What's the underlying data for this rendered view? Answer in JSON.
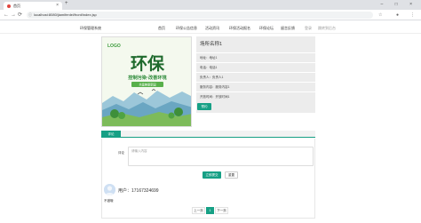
{
  "browser": {
    "tab_title": "首页",
    "tab_close": "×",
    "new_tab": "+",
    "window_controls": "– □ ×",
    "url": "localhost:8080/jiamifenlei/front/index.jsp",
    "back": "←",
    "forward": "→",
    "reload": "⟳",
    "lock": "ⓘ",
    "read_mode": "☆",
    "profile": "●",
    "menu": "⋮"
  },
  "site": {
    "brand": "环保管理系统",
    "nav": [
      "首页",
      "环保公告信息",
      "活动资讯",
      "环保活动报名",
      "环保论坛",
      "留言反馈",
      "登录",
      "跳转到后台"
    ]
  },
  "poster": {
    "logo": "LOGO",
    "headline": "环保",
    "slogan": "控制污染·改善环境",
    "tagline": "共建美丽家园"
  },
  "detail": {
    "title": "场所名称1",
    "fields": [
      {
        "label": "地址：",
        "value": "地址1"
      },
      {
        "label": "电话：",
        "value": "电话1"
      },
      {
        "label": "负责人：",
        "value": "负责人1"
      },
      {
        "label": "服务内容：",
        "value": "服务内容1"
      },
      {
        "label": "开放时间：",
        "value": "开放时间1"
      }
    ],
    "button": "预约"
  },
  "comments": {
    "tab": "评论",
    "label": "评论",
    "placeholder": "请输入内容",
    "submit": "立即提交",
    "reset": "重置",
    "items": [
      {
        "user": "用户：17167324699",
        "text": "不错哦"
      }
    ]
  },
  "pagination": {
    "prev": "上一页",
    "current": "1",
    "next": "下一页"
  },
  "colors": {
    "accent": "#16a085"
  }
}
